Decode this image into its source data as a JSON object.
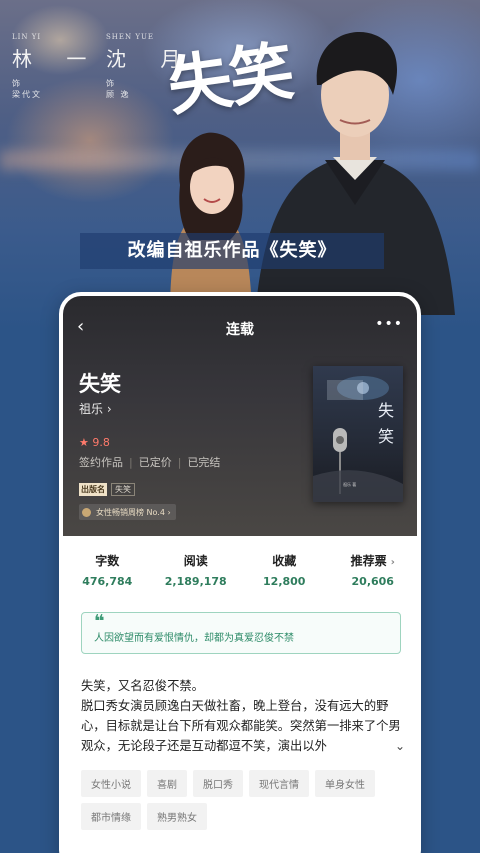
{
  "banner": {
    "cast": [
      {
        "en": "LIN YI",
        "name": "林 一",
        "role_mark": "饰",
        "actor": "梁代文"
      },
      {
        "en": "SHEN YUE",
        "name": "沈 月",
        "role_mark": "饰",
        "actor": "顾 逸"
      }
    ],
    "title_art": "失笑",
    "adaptation_text": "改编自祖乐作品《失笑》"
  },
  "phone": {
    "nav": {
      "title": "连载",
      "back_icon": "chevron-left-icon",
      "more_icon": "more-dots-icon"
    },
    "book": {
      "title": "失笑",
      "author": "祖乐 ›",
      "rating": "★ 9.8",
      "meta": [
        "签约作品",
        "已定价",
        "已完结"
      ],
      "publisher_tag": "出版名",
      "publisher_name": "失笑",
      "rank": "女性畅销周榜 No.4 ›",
      "cover": {
        "title": "失笑",
        "author": "祖乐 著"
      }
    },
    "stats": [
      {
        "label": "字数",
        "value": "476,784"
      },
      {
        "label": "阅读",
        "value": "2,189,178"
      },
      {
        "label": "收藏",
        "value": "12,800"
      },
      {
        "label": "推荐票",
        "value": "20,606",
        "chevron": "›"
      }
    ],
    "quote": {
      "icon": "❝",
      "text": "人因欲望而有爱恨情仇，却都为真爱忍俊不禁"
    },
    "synopsis": {
      "line1": "失笑，又名忍俊不禁。",
      "body": "脱口秀女演员顾逸白天做社畜，晚上登台，没有远大的野心，目标就是让台下所有观众都能笑。突然第一排来了个男观众，无论段子还是互动都逗不笑，演出以外",
      "expand_icon": "⌄"
    },
    "tags": [
      "女性小说",
      "喜剧",
      "脱口秀",
      "现代言情",
      "单身女性",
      "都市情缘",
      "熟男熟女"
    ]
  }
}
